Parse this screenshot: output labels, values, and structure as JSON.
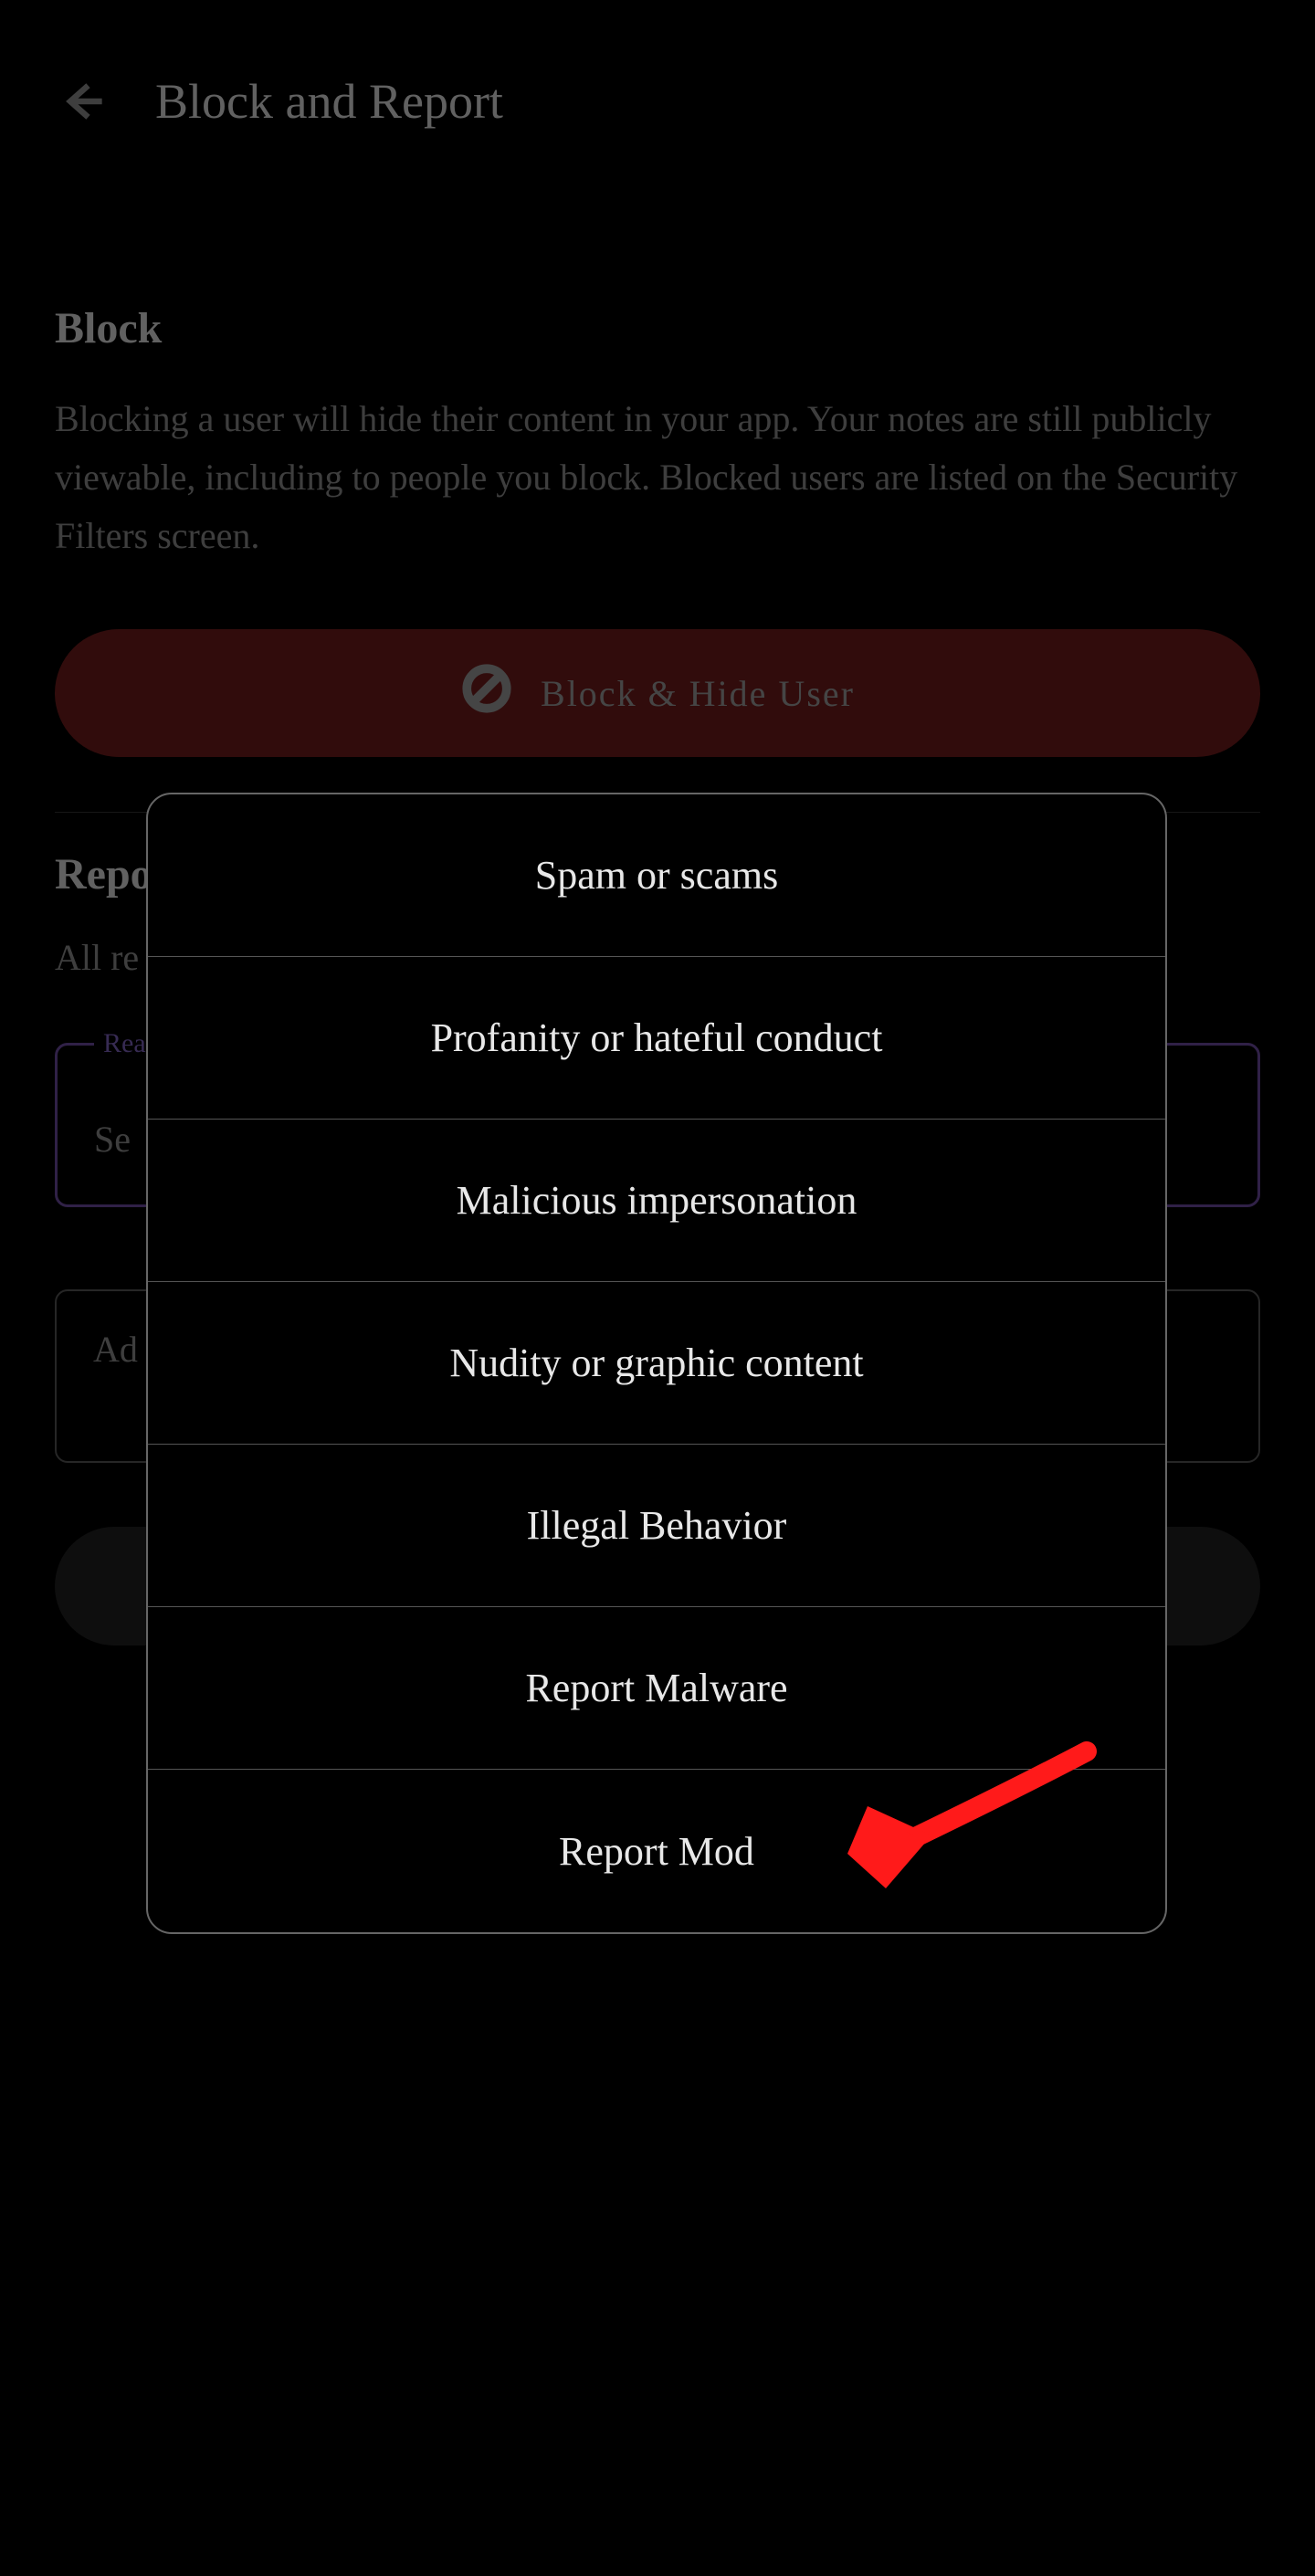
{
  "header": {
    "title": "Block and Report"
  },
  "block": {
    "heading": "Block",
    "body": "Blocking a user will hide their content in your app. Your notes are still publicly viewable, including to people you block. Blocked users are listed on the Security Filters screen.",
    "button_label": "Block & Hide User"
  },
  "report": {
    "heading": "Repo",
    "body_visible": "All re",
    "select_label": "Rea",
    "select_value": "Se",
    "textarea_placeholder": "Ad"
  },
  "modal": {
    "options": [
      "Spam or scams",
      "Profanity or hateful conduct",
      "Malicious impersonation",
      "Nudity or graphic content",
      "Illegal Behavior",
      "Report Malware",
      "Report Mod"
    ]
  },
  "annotation": {
    "description": "hand-drawn red arrow pointing to Report Mod option"
  }
}
